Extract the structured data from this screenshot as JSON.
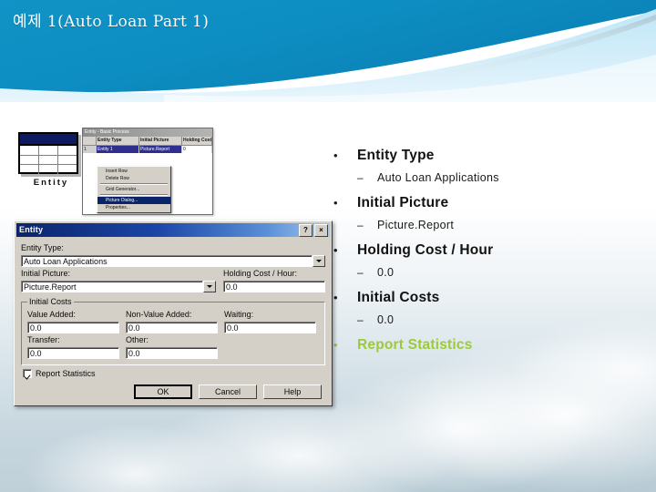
{
  "slide": {
    "title": "예제 1(Auto Loan Part 1)",
    "accent_color": "#9ec93a",
    "header_blue": "#0e8fc0",
    "header_light_blue": "#cdeaf7"
  },
  "bullets": [
    {
      "mark": "•",
      "text": "Entity Type",
      "level": 1,
      "accent": false
    },
    {
      "mark": "–",
      "text": "Auto Loan Applications",
      "level": 2,
      "accent": false
    },
    {
      "mark": "•",
      "text": "Initial Picture",
      "level": 1,
      "accent": false
    },
    {
      "mark": "–",
      "text": "Picture.Report",
      "level": 2,
      "accent": false
    },
    {
      "mark": "•",
      "text": "Holding Cost / Hour",
      "level": 1,
      "accent": false
    },
    {
      "mark": "–",
      "text": "0.0",
      "level": 2,
      "accent": false
    },
    {
      "mark": "•",
      "text": "Initial Costs",
      "level": 1,
      "accent": false
    },
    {
      "mark": "–",
      "text": "0.0",
      "level": 2,
      "accent": false
    },
    {
      "mark": "•",
      "text": "Report Statistics",
      "level": 1,
      "accent": true
    }
  ],
  "entity_module": {
    "label": "Entity"
  },
  "mini_sheet": {
    "title": "Entity - Basic Process",
    "columns": [
      "",
      "Entity Type",
      "Initial Picture",
      "Holding Cost /"
    ],
    "row": [
      "1",
      "Entity 1",
      "Picture.Report",
      "0"
    ],
    "menu_items": [
      {
        "label": "Insert Row",
        "selected": false
      },
      {
        "label": "Delete Row",
        "selected": false
      },
      {
        "label": "Grid Generator...",
        "selected": false
      },
      {
        "label": "Picture Dialog...",
        "selected": true
      },
      {
        "label": "Properties...",
        "selected": false
      }
    ]
  },
  "dialog": {
    "title": "Entity",
    "help_button": "?",
    "close_button": "×",
    "entity_type": {
      "label": "Entity Type:",
      "value": "Auto Loan Applications"
    },
    "initial_picture": {
      "label": "Initial Picture:",
      "value": "Picture.Report"
    },
    "holding_cost": {
      "label": "Holding Cost / Hour:",
      "value": "0.0"
    },
    "initial_costs": {
      "legend": "Initial Costs",
      "fields": [
        {
          "label": "Value Added:",
          "value": "0.0"
        },
        {
          "label": "Non-Value Added:",
          "value": "0.0"
        },
        {
          "label": "Waiting:",
          "value": "0.0"
        },
        {
          "label": "Transfer:",
          "value": "0.0"
        },
        {
          "label": "Other:",
          "value": "0.0"
        }
      ]
    },
    "report_statistics": {
      "label": "Report Statistics",
      "checked": true
    },
    "buttons": [
      {
        "label": "OK",
        "default": true
      },
      {
        "label": "Cancel",
        "default": false
      },
      {
        "label": "Help",
        "default": false
      }
    ]
  }
}
